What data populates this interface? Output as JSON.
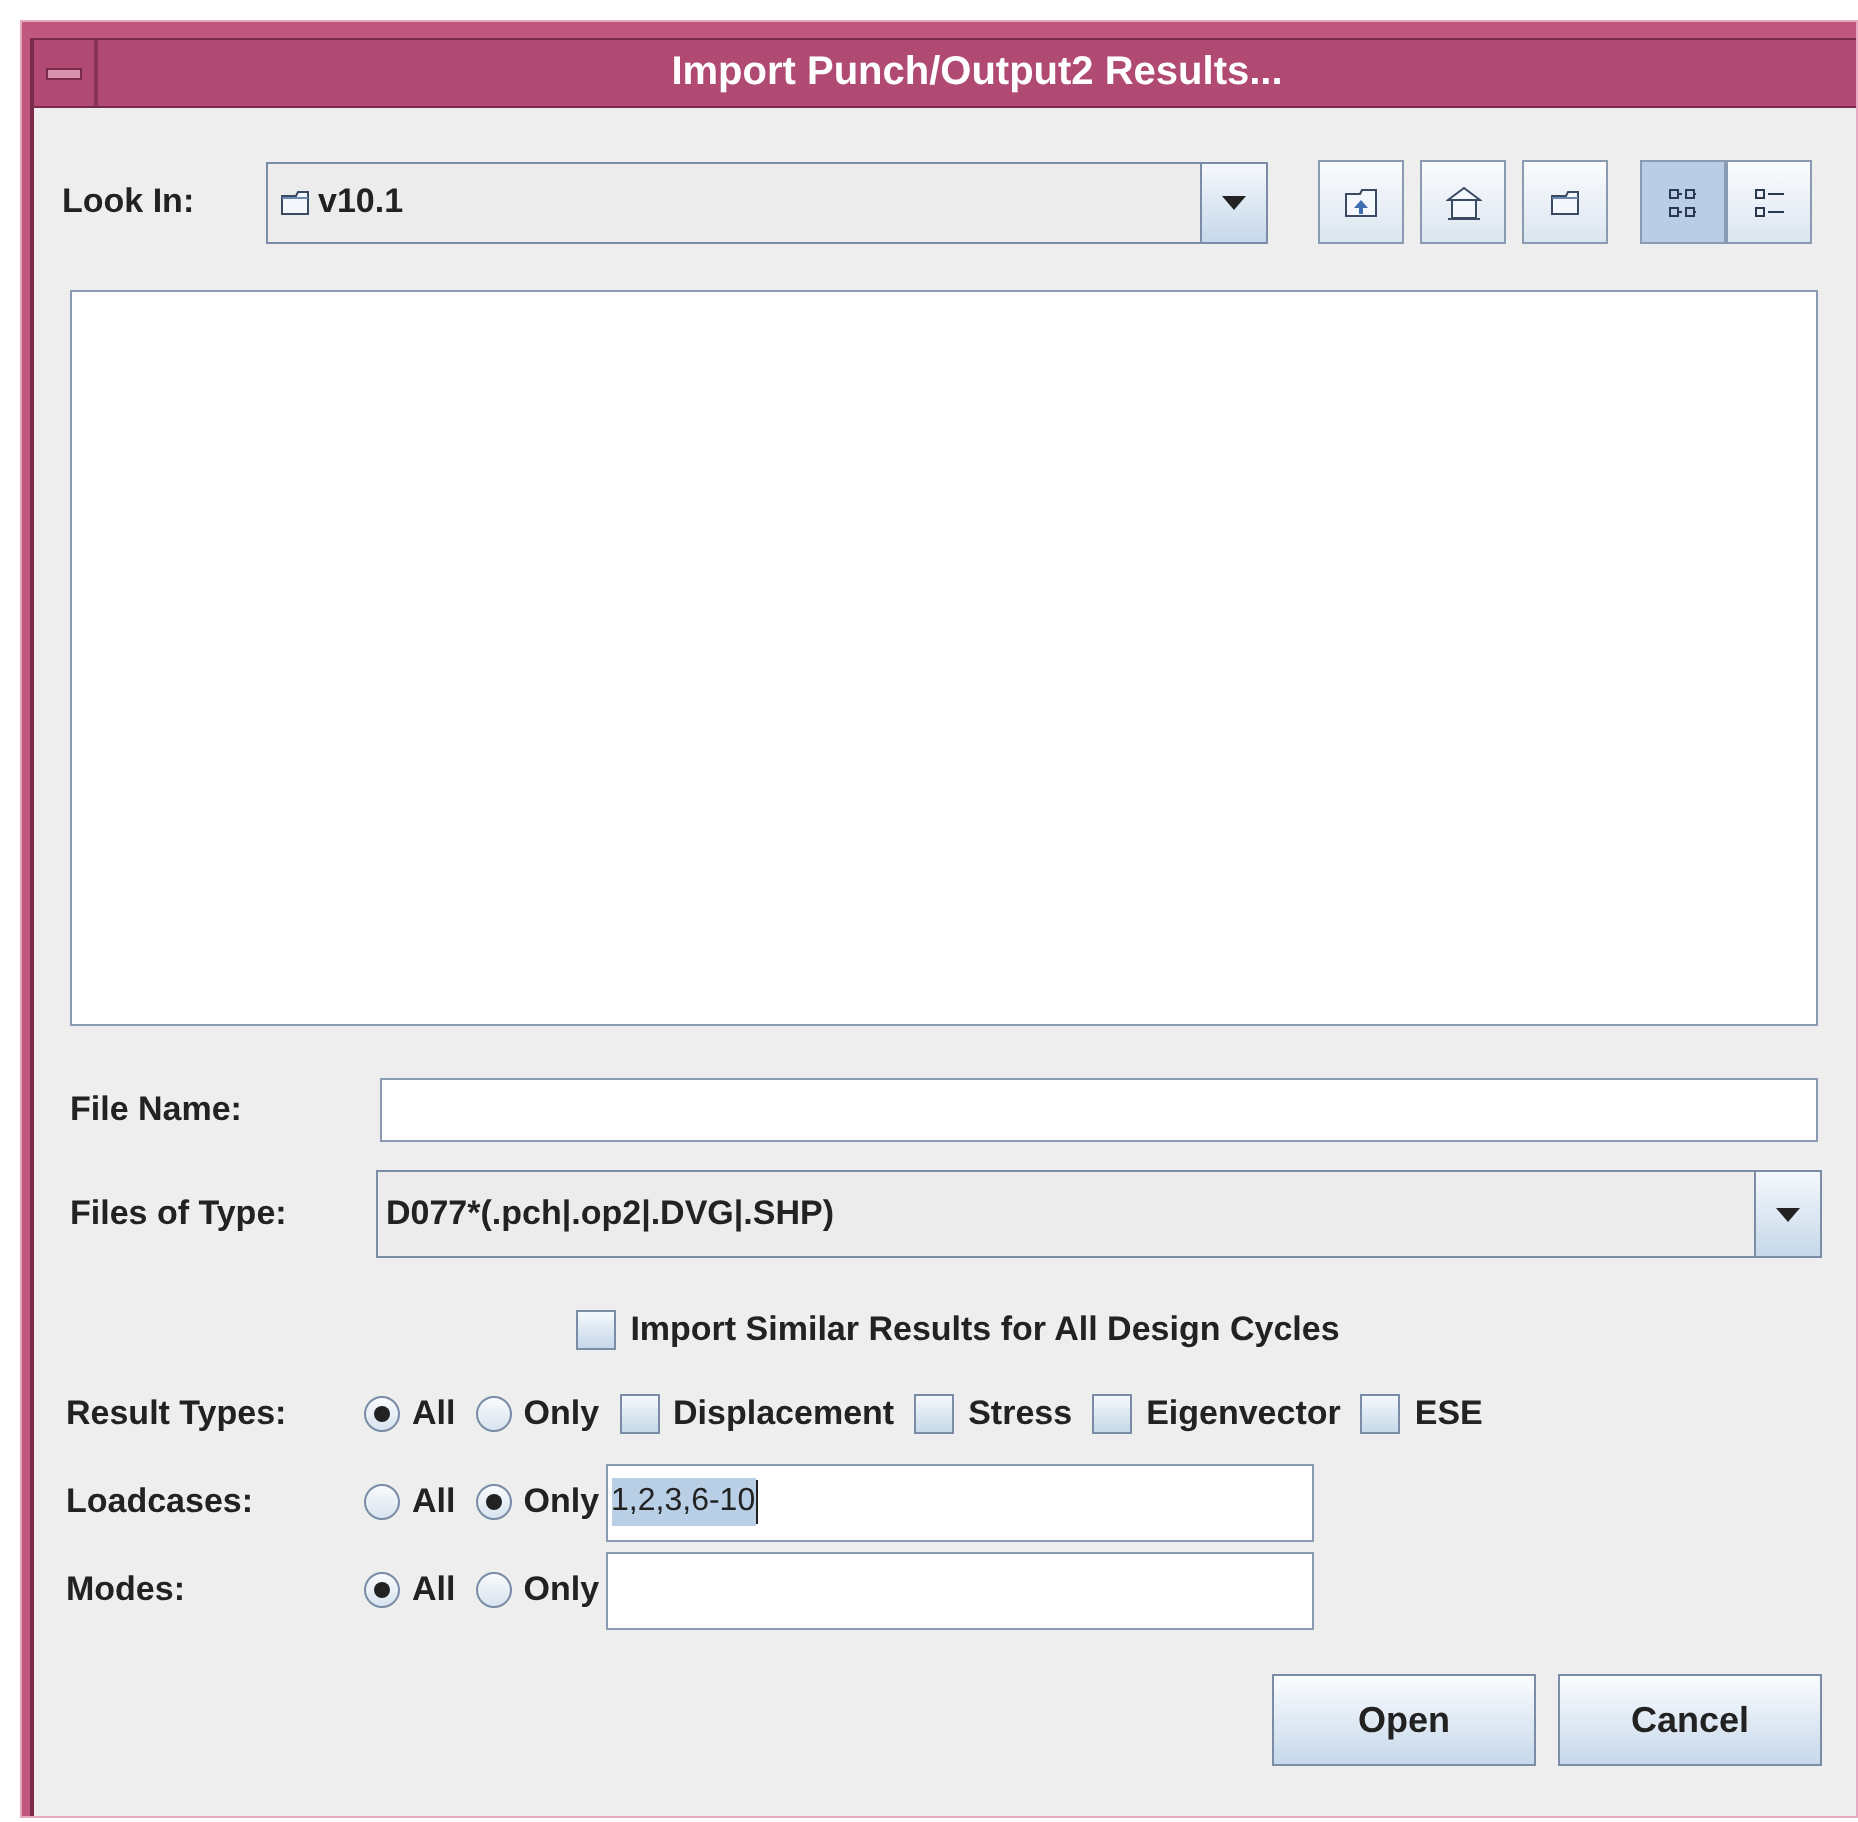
{
  "window": {
    "title": "Import Punch/Output2 Results..."
  },
  "look_in": {
    "label": "Look In:",
    "value": "v10.1"
  },
  "toolbar_buttons": [
    {
      "kind": "up",
      "selected": false
    },
    {
      "kind": "home",
      "selected": false
    },
    {
      "kind": "newfolder",
      "selected": false
    },
    {
      "kind": "list",
      "selected": true
    },
    {
      "kind": "details",
      "selected": false
    }
  ],
  "file_name": {
    "label": "File Name:"
  },
  "files_of_type": {
    "label": "Files of Type:",
    "value": "D077*(.pch|.op2|.DVG|.SHP)"
  },
  "import_similar": {
    "label": "Import Similar Results for All Design Cycles",
    "checked": false
  },
  "options": [
    {
      "kind": "types",
      "label": "Result Types:",
      "choices": [
        {
          "label": "All",
          "selected": true
        },
        {
          "label": "Only",
          "selected": false
        }
      ],
      "types": [
        {
          "label": "Displacement",
          "checked": false
        },
        {
          "label": "Stress",
          "checked": false
        },
        {
          "label": "Eigenvector",
          "checked": false
        },
        {
          "label": "ESE",
          "checked": false
        }
      ]
    },
    {
      "kind": "field",
      "label": "Loadcases:",
      "choices": [
        {
          "label": "All",
          "selected": false
        },
        {
          "label": "Only",
          "selected": true
        }
      ],
      "field": {
        "value": "1,2,3,6-10",
        "text_selected": true
      }
    },
    {
      "kind": "field",
      "label": "Modes:",
      "choices": [
        {
          "label": "All",
          "selected": true
        },
        {
          "label": "Only",
          "selected": false
        }
      ]
    }
  ],
  "buttons": [
    {
      "label": "Open"
    },
    {
      "label": "Cancel"
    }
  ]
}
